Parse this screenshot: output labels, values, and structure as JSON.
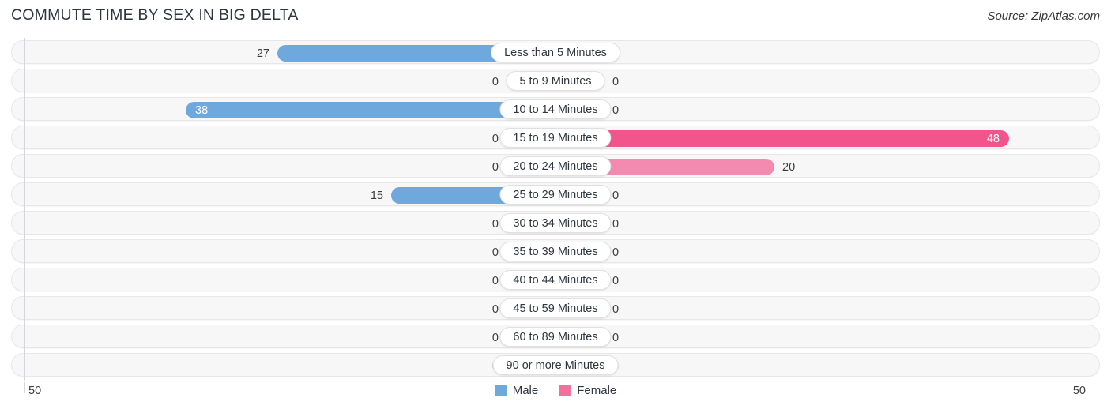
{
  "header": {
    "title": "COMMUTE TIME BY SEX IN BIG DELTA",
    "source": "Source: ZipAtlas.com"
  },
  "legend": {
    "male_label": "Male",
    "female_label": "Female",
    "male_color": "#6fa8dc",
    "female_color": "#f2709c"
  },
  "axis": {
    "left_max": "50",
    "right_max": "50"
  },
  "colors": {
    "male": "#6fa8dc",
    "male_zero": "#a8c8ea",
    "female": "#f58ab0",
    "female_high": "#f2558c",
    "female_zero": "#f9a8c4"
  },
  "chart_data": {
    "type": "bar",
    "title": "COMMUTE TIME BY SEX IN BIG DELTA",
    "subtitle": "Source: ZipAtlas.com",
    "orientation": "horizontal",
    "layout": "diverging-bidirectional",
    "xlabel": "",
    "ylabel": "",
    "xlim": [
      50,
      50
    ],
    "grid": false,
    "legend_position": "bottom-center",
    "categories": [
      "Less than 5 Minutes",
      "5 to 9 Minutes",
      "10 to 14 Minutes",
      "15 to 19 Minutes",
      "20 to 24 Minutes",
      "25 to 29 Minutes",
      "30 to 34 Minutes",
      "35 to 39 Minutes",
      "40 to 44 Minutes",
      "45 to 59 Minutes",
      "60 to 89 Minutes",
      "90 or more Minutes"
    ],
    "series": [
      {
        "name": "Male",
        "values": [
          27,
          0,
          38,
          0,
          0,
          15,
          0,
          0,
          0,
          0,
          0,
          0
        ]
      },
      {
        "name": "Female",
        "values": [
          0,
          0,
          0,
          48,
          20,
          0,
          0,
          0,
          0,
          0,
          0,
          0
        ]
      }
    ]
  },
  "rows": [
    {
      "label": "Less than 5 Minutes",
      "male": "27",
      "female": "0",
      "male_w": 352,
      "female_w": 62,
      "male_inside": false,
      "female_inside": false,
      "male_color": "#6fa8dc",
      "female_color": "#f9a8c4"
    },
    {
      "label": "5 to 9 Minutes",
      "male": "0",
      "female": "0",
      "male_w": 62,
      "female_w": 62,
      "male_inside": false,
      "female_inside": false,
      "male_color": "#a8c8ea",
      "female_color": "#f9a8c4"
    },
    {
      "label": "10 to 14 Minutes",
      "male": "38",
      "female": "0",
      "male_w": 468,
      "female_w": 62,
      "male_inside": true,
      "female_inside": false,
      "male_color": "#6fa8dc",
      "female_color": "#f9a8c4"
    },
    {
      "label": "15 to 19 Minutes",
      "male": "0",
      "female": "48",
      "male_w": 62,
      "female_w": 574,
      "male_inside": false,
      "female_inside": true,
      "male_color": "#a8c8ea",
      "female_color": "#f2558c"
    },
    {
      "label": "20 to 24 Minutes",
      "male": "0",
      "female": "20",
      "male_w": 62,
      "female_w": 277,
      "male_inside": false,
      "female_inside": false,
      "male_color": "#a8c8ea",
      "female_color": "#f58ab0"
    },
    {
      "label": "25 to 29 Minutes",
      "male": "15",
      "female": "0",
      "male_w": 208,
      "female_w": 62,
      "male_inside": false,
      "female_inside": false,
      "male_color": "#6fa8dc",
      "female_color": "#f9a8c4"
    },
    {
      "label": "30 to 34 Minutes",
      "male": "0",
      "female": "0",
      "male_w": 62,
      "female_w": 62,
      "male_inside": false,
      "female_inside": false,
      "male_color": "#a8c8ea",
      "female_color": "#f9a8c4"
    },
    {
      "label": "35 to 39 Minutes",
      "male": "0",
      "female": "0",
      "male_w": 62,
      "female_w": 62,
      "male_inside": false,
      "female_inside": false,
      "male_color": "#a8c8ea",
      "female_color": "#f9a8c4"
    },
    {
      "label": "40 to 44 Minutes",
      "male": "0",
      "female": "0",
      "male_w": 62,
      "female_w": 62,
      "male_inside": false,
      "female_inside": false,
      "male_color": "#a8c8ea",
      "female_color": "#f9a8c4"
    },
    {
      "label": "45 to 59 Minutes",
      "male": "0",
      "female": "0",
      "male_w": 62,
      "female_w": 62,
      "male_inside": false,
      "female_inside": false,
      "male_color": "#a8c8ea",
      "female_color": "#f9a8c4"
    },
    {
      "label": "60 to 89 Minutes",
      "male": "0",
      "female": "0",
      "male_w": 62,
      "female_w": 62,
      "male_inside": false,
      "female_inside": false,
      "male_color": "#a8c8ea",
      "female_color": "#f9a8c4"
    },
    {
      "label": "90 or more Minutes",
      "male": "0",
      "female": "0",
      "male_w": 62,
      "female_w": 62,
      "male_inside": false,
      "female_inside": false,
      "male_color": "#a8c8ea",
      "female_color": "#f9a8c4"
    }
  ]
}
